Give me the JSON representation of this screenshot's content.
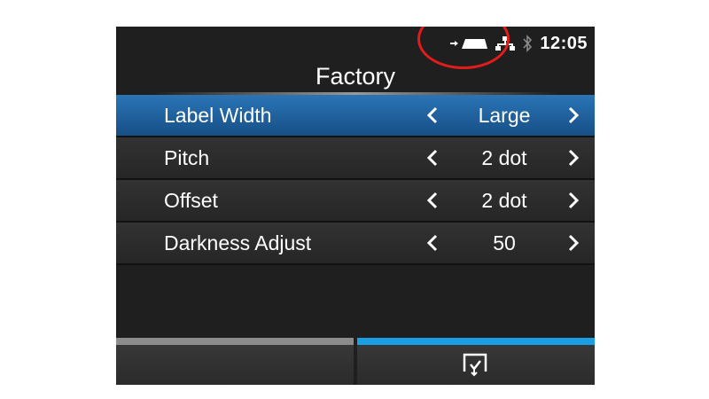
{
  "status_bar": {
    "time": "12:05",
    "icons": [
      "media-feed-icon",
      "network-icon",
      "bluetooth-icon"
    ],
    "highlight_color": "#e21b1b"
  },
  "screen": {
    "title": "Factory"
  },
  "menu": {
    "items": [
      {
        "label": "Label Width",
        "value": "Large",
        "selected": true
      },
      {
        "label": "Pitch",
        "value": "2 dot",
        "selected": false
      },
      {
        "label": "Offset",
        "value": "2 dot",
        "selected": false
      },
      {
        "label": "Darkness Adjust",
        "value": "50",
        "selected": false
      }
    ]
  },
  "footer": {
    "left_button_icon": "",
    "right_button_icon": "print-check-icon",
    "accent_color": "#1a9ee6"
  },
  "colors": {
    "selection": "#2a74b6",
    "background": "#1f1f1f"
  }
}
